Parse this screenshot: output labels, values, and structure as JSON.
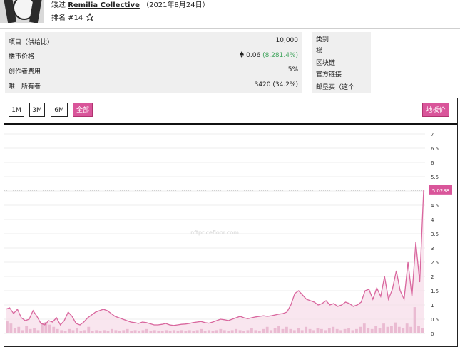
{
  "header": {
    "created_prefix": "矮过",
    "creator": "Remilia Collective",
    "date": "（2021年8月24日）",
    "rank": "排名 #14"
  },
  "stats": [
    {
      "label": "项目（供给比）",
      "value": "10,000"
    },
    {
      "label": "楼市价格",
      "value": "0.06",
      "change": "(8,281.4%)"
    },
    {
      "label": "创作者费用",
      "value": "5%"
    },
    {
      "label": "唯一所有者",
      "value": "3420 (34.2%)"
    }
  ],
  "meta": [
    "类别",
    "梯",
    "区块链",
    "官方链接",
    "邮垦买（这个"
  ],
  "toolbar": {
    "ranges": [
      "1M",
      "3M",
      "6M",
      "全部"
    ],
    "active_range": "全部",
    "floor_button": "地板价"
  },
  "chart_data": {
    "type": "area",
    "y_ticks": [
      "7",
      "6.5",
      "6",
      "5.5",
      "5",
      "4.5",
      "4",
      "3.5",
      "3",
      "2.5",
      "2",
      "1.5",
      "1",
      "0.5",
      "0"
    ],
    "ylim": [
      0,
      7
    ],
    "current_value": "5.0288",
    "watermark": "nftpricefloor.com",
    "floor_series": [
      0.85,
      0.9,
      0.7,
      0.85,
      0.55,
      0.45,
      0.5,
      0.8,
      0.6,
      0.35,
      0.3,
      0.45,
      0.4,
      0.55,
      0.3,
      0.45,
      0.75,
      0.6,
      0.35,
      0.3,
      0.4,
      0.55,
      0.65,
      0.75,
      0.8,
      0.85,
      0.8,
      0.7,
      0.6,
      0.55,
      0.5,
      0.45,
      0.4,
      0.38,
      0.35,
      0.4,
      0.38,
      0.34,
      0.3,
      0.3,
      0.32,
      0.35,
      0.3,
      0.28,
      0.3,
      0.32,
      0.33,
      0.35,
      0.38,
      0.4,
      0.42,
      0.38,
      0.36,
      0.4,
      0.45,
      0.5,
      0.48,
      0.45,
      0.5,
      0.55,
      0.6,
      0.55,
      0.52,
      0.55,
      0.58,
      0.6,
      0.62,
      0.6,
      0.62,
      0.65,
      0.68,
      0.7,
      0.75,
      1.0,
      1.4,
      1.5,
      1.35,
      1.2,
      1.15,
      1.1,
      1.0,
      1.05,
      1.15,
      1.0,
      1.05,
      0.95,
      1.0,
      1.1,
      1.05,
      0.95,
      1.0,
      1.1,
      1.5,
      1.55,
      1.2,
      1.6,
      1.3,
      2.0,
      1.2,
      1.55,
      2.2,
      1.5,
      1.2,
      2.5,
      1.3,
      3.2,
      1.8,
      5.0288
    ],
    "volume_series": [
      1.1,
      0.9,
      0.5,
      0.6,
      0.3,
      0.7,
      0.4,
      0.5,
      0.3,
      0.9,
      1.0,
      0.8,
      0.6,
      0.4,
      0.3,
      0.2,
      0.4,
      0.3,
      0.5,
      0.2,
      0.3,
      0.6,
      0.2,
      0.3,
      0.2,
      0.3,
      0.2,
      0.4,
      0.3,
      0.2,
      0.3,
      0.4,
      0.2,
      0.3,
      0.2,
      0.3,
      0.4,
      0.2,
      0.3,
      0.2,
      0.2,
      0.3,
      0.2,
      0.3,
      0.2,
      0.3,
      0.2,
      0.3,
      0.2,
      0.3,
      0.4,
      0.2,
      0.3,
      0.2,
      0.3,
      0.4,
      0.3,
      0.2,
      0.3,
      0.4,
      0.3,
      0.2,
      0.3,
      0.5,
      0.3,
      0.2,
      0.4,
      0.6,
      0.3,
      0.5,
      0.7,
      0.4,
      0.6,
      0.4,
      0.3,
      0.5,
      0.3,
      0.6,
      0.4,
      0.3,
      0.5,
      0.4,
      0.3,
      0.5,
      0.6,
      0.4,
      0.3,
      0.4,
      0.5,
      0.3,
      0.4,
      0.6,
      0.9,
      0.5,
      0.4,
      0.7,
      0.5,
      0.9,
      0.6,
      0.7,
      1.0,
      0.6,
      0.5,
      0.9,
      0.6,
      2.4,
      0.7,
      0.5
    ]
  }
}
